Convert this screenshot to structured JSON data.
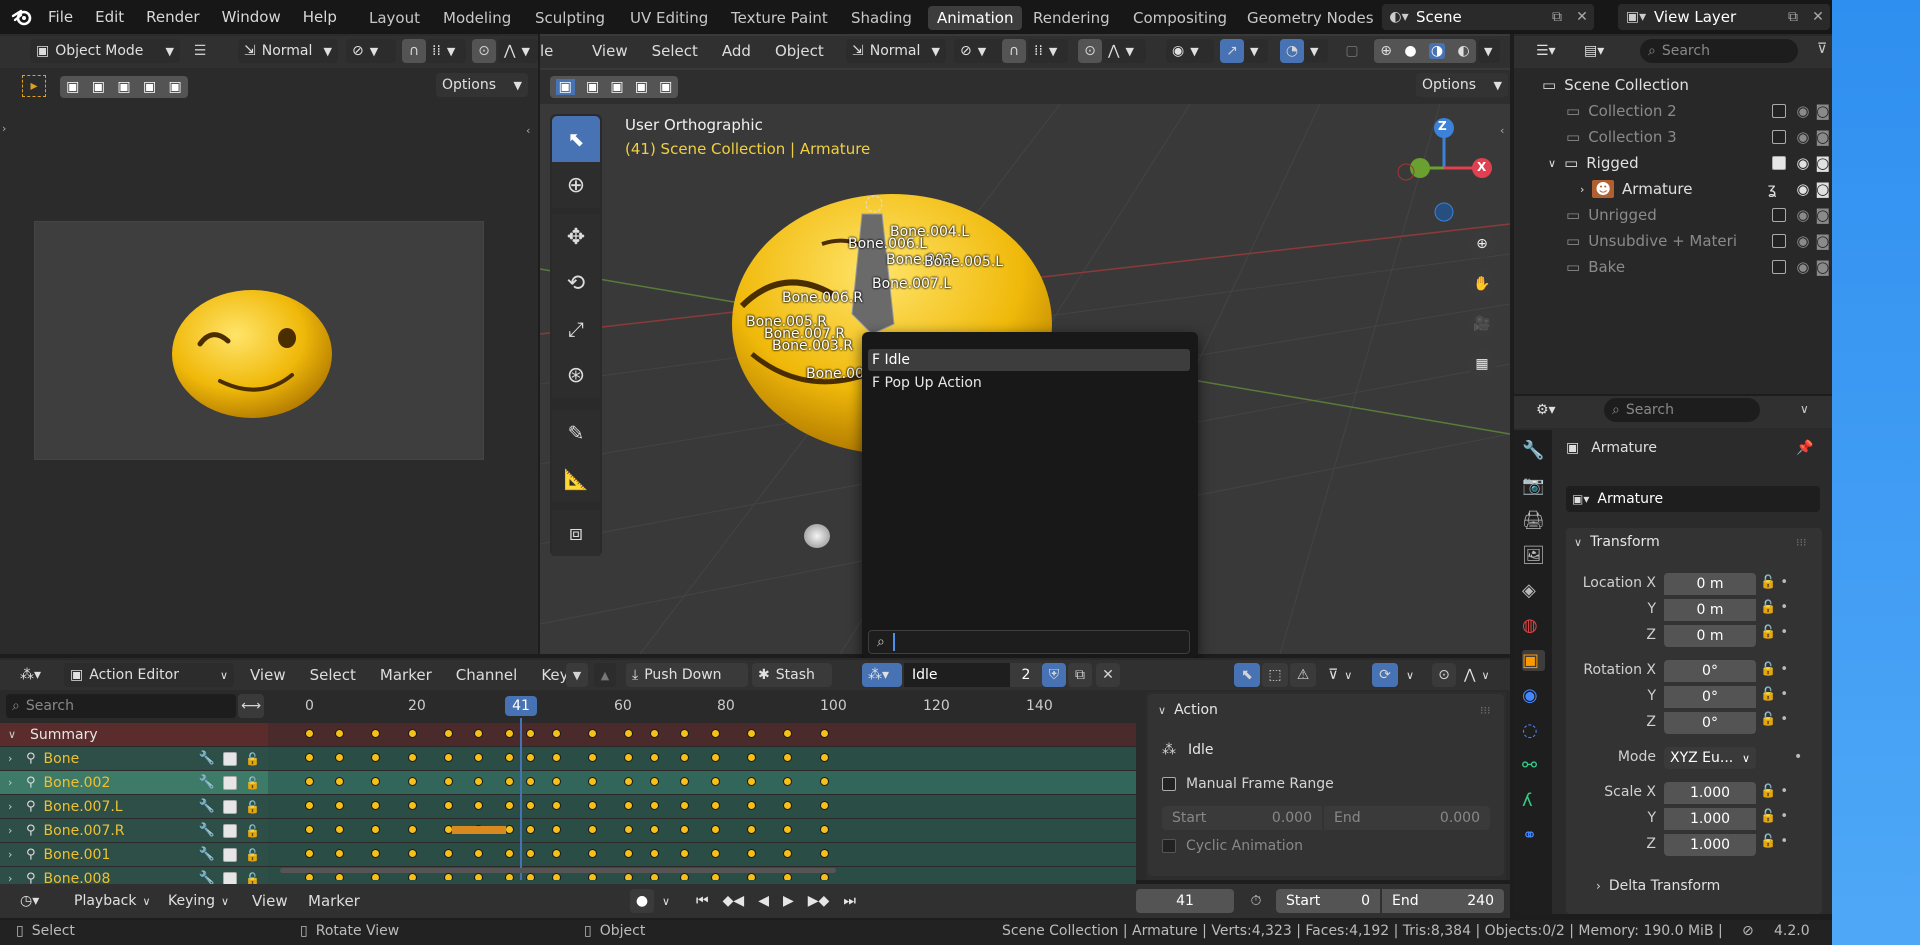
{
  "top_menu": {
    "items": [
      "File",
      "Edit",
      "Render",
      "Window",
      "Help"
    ]
  },
  "workspaces": [
    {
      "label": "Layout"
    },
    {
      "label": "Modeling"
    },
    {
      "label": "Sculpting"
    },
    {
      "label": "UV Editing"
    },
    {
      "label": "Texture Paint"
    },
    {
      "label": "Shading"
    },
    {
      "label": "Animation",
      "active": true
    },
    {
      "label": "Rendering"
    },
    {
      "label": "Compositing"
    },
    {
      "label": "Geometry Nodes"
    }
  ],
  "scene": {
    "name": "Scene",
    "view_layer": "View Layer"
  },
  "camera_view": {
    "mode": "Object Mode",
    "orientation": "Normal",
    "options": "Options"
  },
  "viewport": {
    "menu_partial": "le",
    "menus": [
      "View",
      "Select",
      "Add",
      "Object"
    ],
    "orientation": "Normal",
    "options": "Options",
    "overlay_title": "User Orthographic",
    "overlay_subtitle": "(41) Scene Collection | Armature",
    "gizmo": {
      "z": "Z",
      "x": "X"
    },
    "bones": [
      "Bone.004.L",
      "Bone.006.L",
      "Bone.002",
      "Bone.005.L",
      "Bone.007.L",
      "Bone.006.R",
      "Bone.005.R",
      "Bone.007.R",
      "Bone.003.R",
      "Bone.00"
    ]
  },
  "popup": {
    "items": [
      "F Idle",
      "F Pop Up Action"
    ],
    "search_value": ""
  },
  "outliner": {
    "search_placeholder": "Search",
    "root": "Scene Collection",
    "rows": [
      {
        "label": "Collection 2",
        "enabled": false,
        "checked": false
      },
      {
        "label": "Collection 3",
        "enabled": false,
        "checked": false
      },
      {
        "label": "Rigged",
        "enabled": true,
        "checked": true
      },
      {
        "label": "Armature",
        "enabled": true,
        "checked": false
      },
      {
        "label": "Unrigged",
        "enabled": false,
        "checked": false
      },
      {
        "label": "Unsubdive + Materi",
        "enabled": false,
        "checked": false
      },
      {
        "label": "Bake",
        "enabled": false,
        "checked": false
      }
    ]
  },
  "properties": {
    "search_placeholder": "Search",
    "object_title": "Armature",
    "object_name": "Armature",
    "transform_label": "Transform",
    "location_x_label": "Location X",
    "location_x": "0 m",
    "location_y_label": "Y",
    "location_y": "0 m",
    "location_z_label": "Z",
    "location_z": "0 m",
    "rotation_x_label": "Rotation X",
    "rotation_x": "0°",
    "rotation_y_label": "Y",
    "rotation_y": "0°",
    "rotation_z_label": "Z",
    "rotation_z": "0°",
    "mode_label": "Mode",
    "mode_value": "XYZ Eu...",
    "scale_x_label": "Scale X",
    "scale_x": "1.000",
    "scale_y_label": "Y",
    "scale_y": "1.000",
    "scale_z_label": "Z",
    "scale_z": "1.000",
    "delta_label": "Delta Transform"
  },
  "action_editor": {
    "mode": "Action Editor",
    "menus": [
      "View",
      "Select",
      "Marker",
      "Channel",
      "Key"
    ],
    "push_down": "Push Down",
    "stash": "Stash",
    "action_name": "Idle",
    "users": "2",
    "search_placeholder": "Search",
    "ruler": [
      "0",
      "20",
      "41",
      "60",
      "80",
      "100",
      "120",
      "140"
    ],
    "current_frame": "41",
    "channels": [
      {
        "label": "Summary",
        "type": "summary"
      },
      {
        "label": "Bone",
        "type": "group"
      },
      {
        "label": "Bone.002",
        "type": "group",
        "selected": true
      },
      {
        "label": "Bone.007.L",
        "type": "group"
      },
      {
        "label": "Bone.007.R",
        "type": "group"
      },
      {
        "label": "Bone.001",
        "type": "group"
      },
      {
        "label": "Bone.008",
        "type": "group"
      }
    ],
    "keyframe_frames": [
      0,
      6,
      13,
      20,
      27,
      33,
      39,
      43,
      48,
      55,
      62,
      67,
      73,
      79,
      86,
      93,
      100
    ],
    "sidebar": {
      "panel": "Action",
      "action": "Idle",
      "manual_frame_range": "Manual Frame Range",
      "start_label": "Start",
      "start_value": "0.000",
      "end_label": "End",
      "end_value": "0.000",
      "cyclic": "Cyclic Animation"
    }
  },
  "timeline": {
    "menus": [
      "Playback",
      "Keying",
      "View",
      "Marker"
    ],
    "current_frame": "41",
    "start_label": "Start",
    "start": "0",
    "end_label": "End",
    "end": "240"
  },
  "statusbar": {
    "select": "Select",
    "rotate": "Rotate View",
    "object": "Object",
    "stats": "Scene Collection | Armature | Verts:4,323 | Faces:4,192 | Tris:8,384 | Objects:0/2 | Memory: 190.0 MiB |",
    "version": "4.2.0"
  },
  "colors": {
    "accent": "#4772b3",
    "keyframe": "#f6c019",
    "active_tab": "#3d3d3d",
    "summary_row": "#5a2c2c",
    "group_row": "#2d5a4e"
  }
}
